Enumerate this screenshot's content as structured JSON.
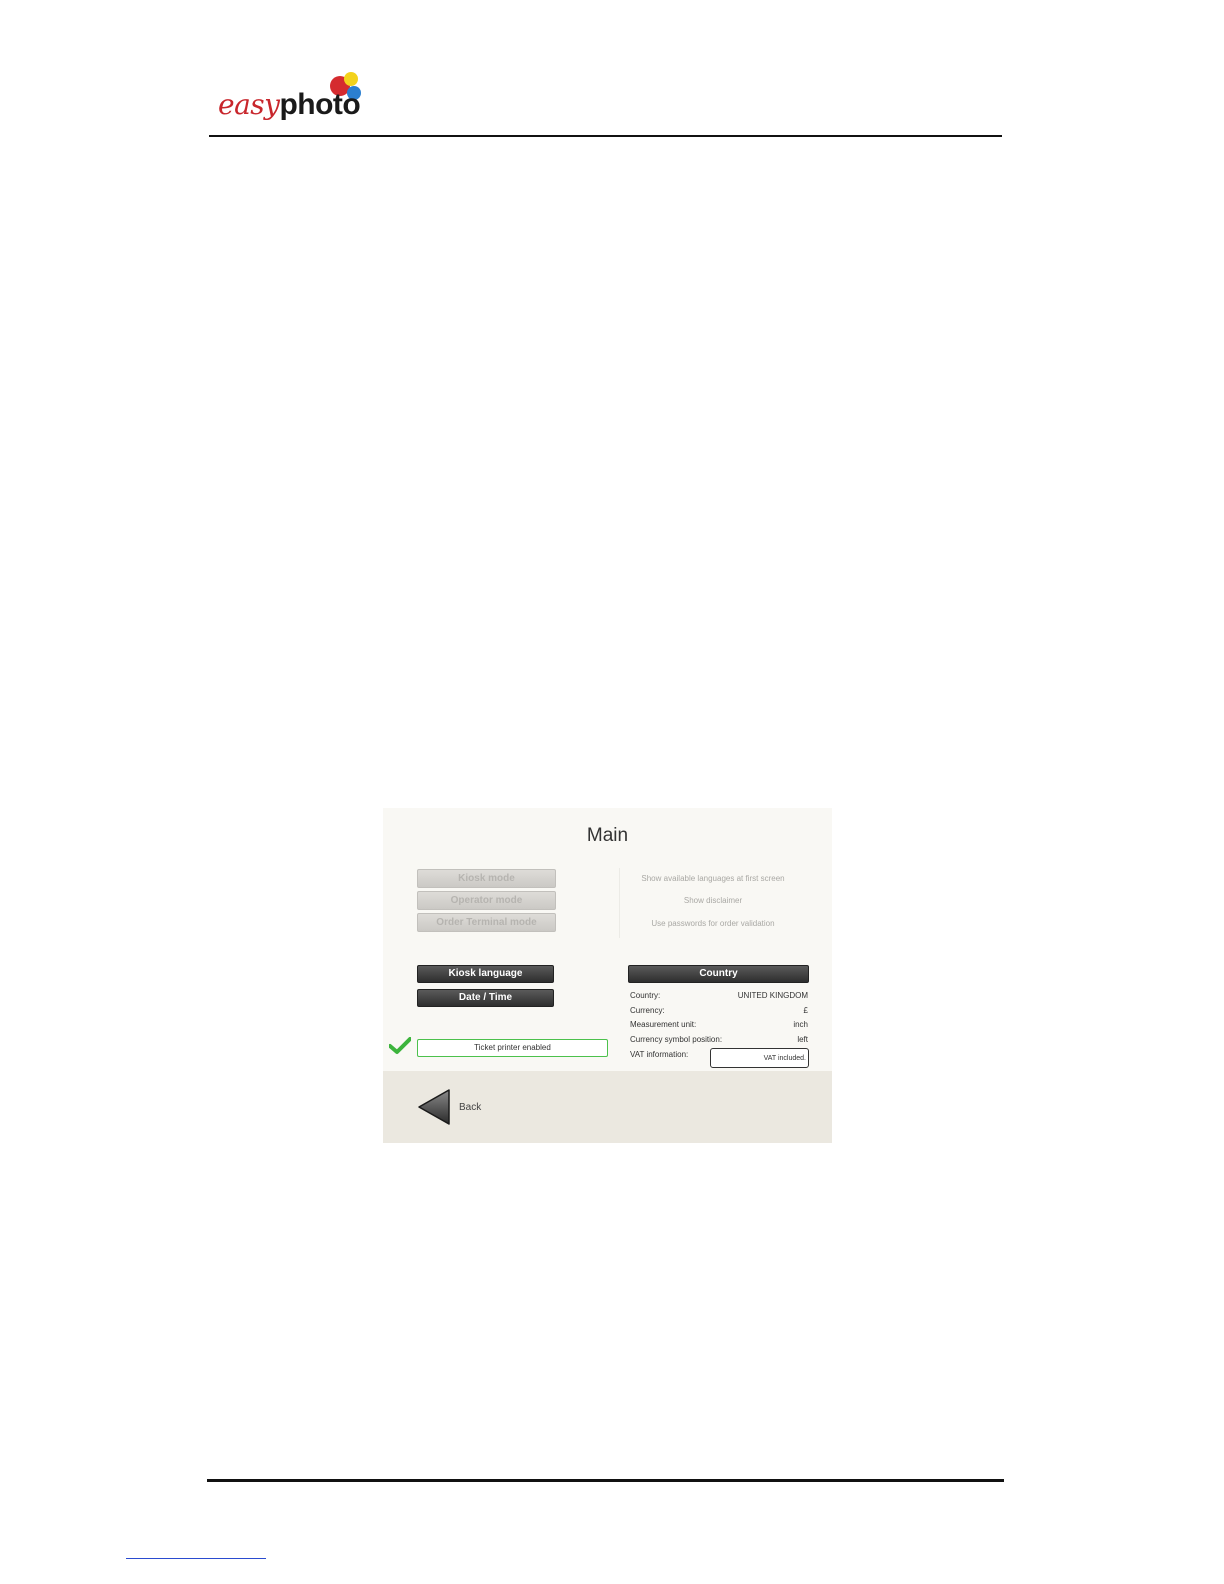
{
  "header": {
    "logo_easy": "easy",
    "logo_photo": "photo"
  },
  "screen": {
    "title": "Main",
    "modes": [
      "Kiosk mode",
      "Operator mode",
      "Order Terminal mode"
    ],
    "options": [
      "Show available languages at first screen",
      "Show disclaimer",
      "Use passwords for order validation"
    ],
    "buttons": {
      "kiosk_language": "Kiosk language",
      "date_time": "Date / Time",
      "country": "Country"
    },
    "ticket_printer": "Ticket printer enabled",
    "country_info": [
      {
        "label": "Country:",
        "value": "UNITED KINGDOM"
      },
      {
        "label": "Currency:",
        "value": "£"
      },
      {
        "label": "Measurement unit:",
        "value": "inch"
      },
      {
        "label": "Currency symbol position:",
        "value": "left"
      },
      {
        "label": "VAT information:",
        "value": ""
      }
    ],
    "vat_value": "VAT included.",
    "back_label": "Back"
  },
  "colors": {
    "check_green": "#3cb43c",
    "logo_red": "#d52b2f",
    "logo_yellow": "#f3d21c",
    "logo_blue": "#2b7fd0"
  },
  "icons": [
    "checkmark-icon",
    "back-arrow-icon"
  ]
}
